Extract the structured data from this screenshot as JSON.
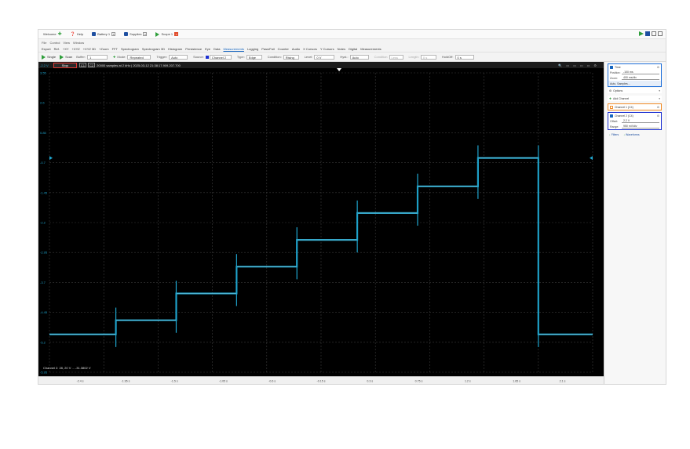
{
  "tabs": [
    {
      "label": "Welcome",
      "icon": "plus-icon",
      "color": "#2e9e3a",
      "closable": false,
      "active": false
    },
    {
      "label": "Help",
      "icon": "help-icon",
      "color": "#1e6fd9",
      "closable": false,
      "active": false
    },
    {
      "label": "Battery 1",
      "icon": "battery-icon",
      "color": "#1e4fa0",
      "closable": true,
      "active": false
    },
    {
      "label": "Supplies",
      "icon": "supply-icon",
      "color": "#1e4fa0",
      "closable": true,
      "active": false
    },
    {
      "label": "Scope 1",
      "icon": "scope-icon",
      "color": "#2e9e3a",
      "closable": true,
      "active": true
    }
  ],
  "menu": [
    "File",
    "Control",
    "View",
    "Window"
  ],
  "features": [
    "Export",
    "Ref.",
    "+XY",
    "+XYZ",
    "+XYZ 3D",
    "+Zoom",
    "FFT",
    "Spectrogram",
    "Spectrogram 3D",
    "Histogram",
    "Persistence",
    "Eye",
    "Data",
    "Measurements",
    "Logging",
    "Pass/Fail",
    "Counter",
    "Audio",
    "X Cursors",
    "Y Cursors",
    "Notes",
    "Digital",
    "Measurements"
  ],
  "features_selected": 13,
  "toolbar": {
    "single": "Single",
    "scan": "Scan",
    "buffer_label": "Buffer:",
    "buffer_value": "1",
    "mode_label": "Mode:",
    "mode_value": "Repeated",
    "trigger_label": "Trigger:",
    "trigger_value": "Auto",
    "source_label": "Source:",
    "source_value": "Channel 2",
    "type_label": "Type:",
    "type_value": "Edge",
    "condition_label": "Condition:",
    "condition_value": "Rising",
    "level_label": "Level:",
    "level_value": "0 V",
    "hyst_label": "Hyst.:",
    "hyst_value": "Auto",
    "condition2_label": "Condition",
    "cond2_value": "Less",
    "length_label": "Length:",
    "length_value": "0 s",
    "holdoff_label": "HoldOff:",
    "holdoff_value": "0 s"
  },
  "scope": {
    "stop_label": "Stop",
    "ch1": "C1",
    "ch2": "C2",
    "info": "20000 samples at 2 kHz  |  2025-03-12 21:38:17.909.207.700",
    "corner_label": "-2.2 V",
    "cursor_readout": "Channel 2: 28, 20 V ... -31.3802 V",
    "y_ticks": [
      "3.55",
      "2.6",
      "0.85",
      "-0.7",
      "-1.45",
      "-2.2",
      "-2.95",
      "-3.7",
      "-4.45",
      "-5.2",
      "-5.95"
    ],
    "x_ticks": [
      "-2.4 s",
      "-1.95 s",
      "-1.5 s",
      "-1.05 s",
      "-0.6 s",
      "-0.15 s",
      "0.3 s",
      "0.75 s",
      "1.2 s",
      "1.65 s",
      "2.1 s"
    ],
    "trace_color": "#1fa6cf",
    "stop_color": "#e53935"
  },
  "chart_data": {
    "type": "line",
    "title": "",
    "xlabel": "",
    "ylabel": "",
    "xlim": [
      -2.4,
      2.1
    ],
    "ylim": [
      -5.95,
      3.55
    ],
    "grid": true,
    "series": [
      {
        "x": [
          -2.4,
          -1.85,
          -1.85,
          -1.35,
          -1.35,
          -0.85,
          -0.85,
          -0.35,
          -0.35,
          0.15,
          0.15,
          0.65,
          0.65,
          1.15,
          1.15,
          1.65,
          1.65,
          2.1
        ],
        "y": [
          -4.75,
          -4.75,
          -4.3,
          -4.3,
          -3.45,
          -3.45,
          -2.6,
          -2.6,
          -1.75,
          -1.75,
          -0.9,
          -0.9,
          -0.05,
          -0.05,
          0.85,
          0.85,
          -4.75,
          -4.75
        ]
      }
    ]
  },
  "panel": {
    "time": {
      "title": "Time",
      "position_label": "Position:",
      "position_value": "-100 ms",
      "zoom_label": "Zoom:",
      "zoom_value": "400 ms/div",
      "auto_label": "Auto, Samples..."
    },
    "options": "Options",
    "add_channel": "Add Channel",
    "channel1": "Channel 1 (C4)",
    "channel2": {
      "title": "Channel 2 (C4)",
      "offset_label": "Offset:",
      "offset_value": "2.2 V",
      "range_label": "Range:",
      "range_value": "950 mV/div"
    },
    "filters": "Filters",
    "waveforms": "Waveforms",
    "time_color": "#1e6fd9",
    "ch1_color": "#f08a24",
    "ch2_color": "#1b2fd1"
  }
}
